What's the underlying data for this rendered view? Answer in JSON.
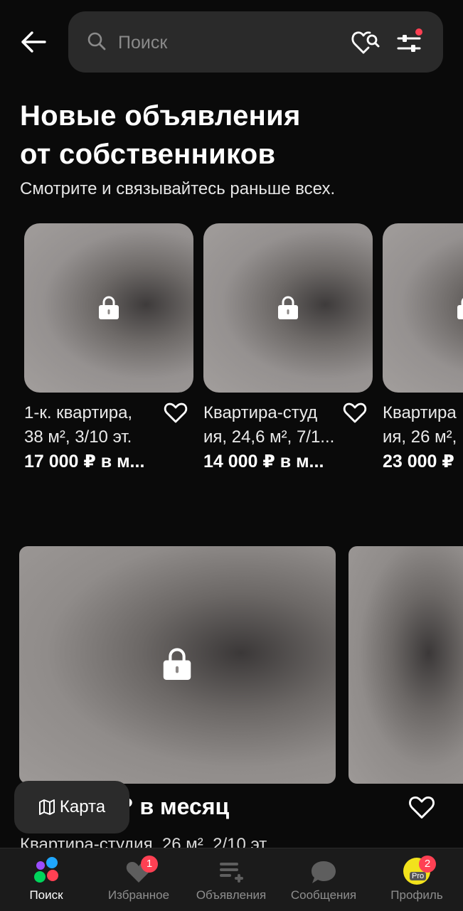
{
  "search": {
    "placeholder": "Поиск"
  },
  "section": {
    "title_line1": "Новые объявления",
    "title_line2": "от собственников",
    "subtitle": "Смотрите и связывайтесь раньше всех."
  },
  "cards": [
    {
      "name_line1": "1-к. квартира,",
      "name_line2": "38 м², 3/10 эт.",
      "price": "17 000 ₽ в м..."
    },
    {
      "name_line1": "Квартира-студ",
      "name_line2": "ия, 24,6 м², 7/1...",
      "price": "14 000 ₽ в м..."
    },
    {
      "name_line1": "Квартира",
      "name_line2": "ия, 26 м²,",
      "price": "23 000 ₽"
    }
  ],
  "listing": {
    "price_fragment": "? в месяц",
    "description": "Квартира-студия, 26 м², 2/10 эт."
  },
  "map_button": {
    "label": "Карта"
  },
  "nav": {
    "search": "Поиск",
    "favorites": "Избранное",
    "favorites_badge": "1",
    "ads": "Объявления",
    "messages": "Сообщения",
    "profile": "Профиль",
    "profile_badge": "2",
    "profile_avatar_text": "Pro"
  },
  "colors": {
    "background": "#0a0a0a",
    "surface": "#2a2a2a",
    "accent_red": "#ff4053",
    "muted_text": "#8e8e8e"
  }
}
